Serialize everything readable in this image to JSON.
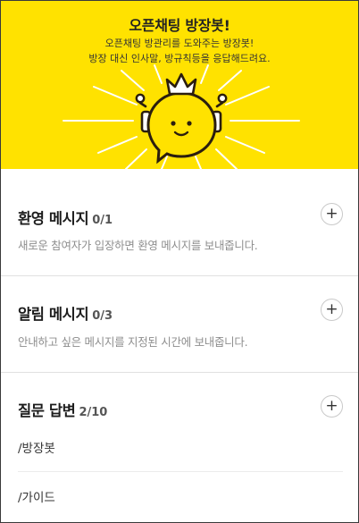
{
  "hero": {
    "title": "오픈채팅 방장봇!",
    "desc_line1": "오픈채팅 방관리를 도와주는 방장봇!",
    "desc_line2": "방장 대신 인사말, 방규칙등을 응답해드려요.",
    "bg_color": "#ffe200",
    "mascot_icon": "crowned-speech-bubble-mascot"
  },
  "sections": [
    {
      "title": "환영 메시지",
      "count": "0/1",
      "desc": "새로운 참여자가 입장하면 환영 메시지를 보내줍니다.",
      "add_icon": "+"
    },
    {
      "title": "알림 메시지",
      "count": "0/3",
      "desc": "안내하고 싶은 메시지를 지정된 시간에 보내줍니다.",
      "add_icon": "+"
    },
    {
      "title": "질문 답변",
      "count": "2/10",
      "add_icon": "+",
      "commands": [
        "/방장봇",
        "/가이드"
      ]
    }
  ]
}
